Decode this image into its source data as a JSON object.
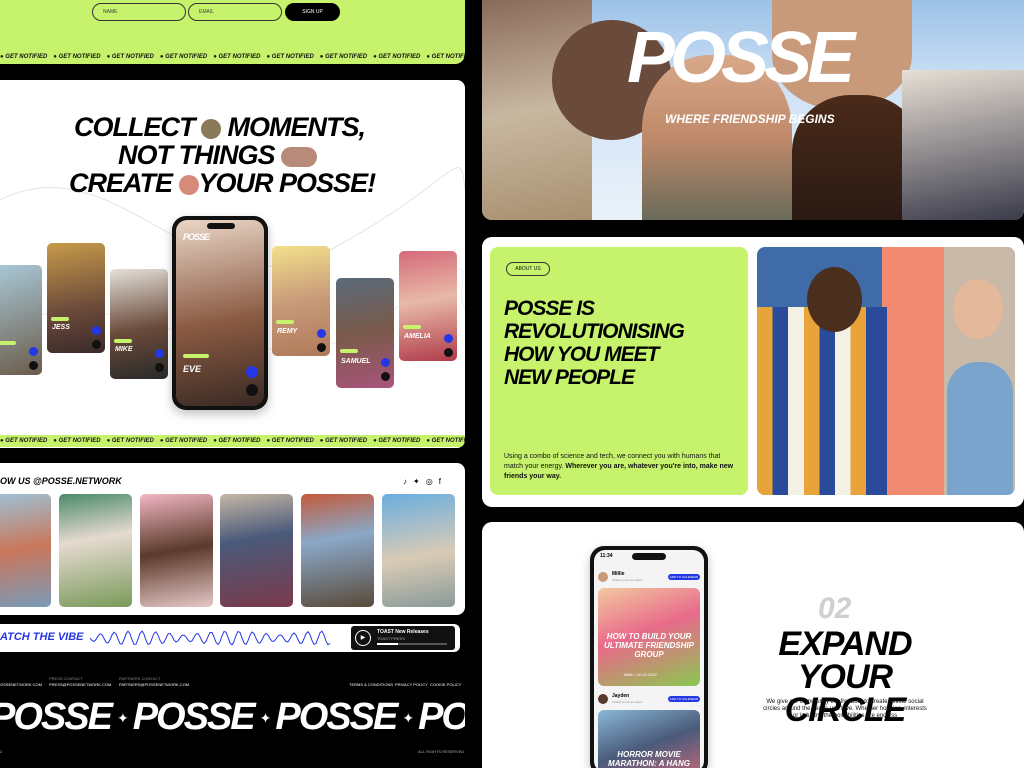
{
  "signup": {
    "name_placeholder": "NAME",
    "email_placeholder": "EMAIL",
    "button": "SIGN UP"
  },
  "ticker_text": "GET NOTIFIED",
  "hero": {
    "line1_a": "COLLECT",
    "line1_b": "MOMENTS,",
    "line2": "NOT THINGS",
    "line3_a": "CREATE",
    "line3_b": "YOUR POSSE!"
  },
  "profiles": [
    {
      "name": "JESS"
    },
    {
      "name": "MIKE"
    },
    {
      "name": "EVE"
    },
    {
      "name": "REMY"
    },
    {
      "name": "SAMUEL"
    },
    {
      "name": "AMELIA"
    }
  ],
  "phone_logo": "POSSE",
  "follow": {
    "prefix": "OW US",
    "handle": "@POSSE.NETWORK"
  },
  "social_icons": [
    "tiktok-icon",
    "twitter-icon",
    "instagram-icon",
    "facebook-icon"
  ],
  "vibe": {
    "label": "ATCH THE VIBE",
    "player_title": "TOAST New Releases",
    "player_sub": "TOAST PRESS"
  },
  "footer": {
    "email1": "OSSENETWORK.COM",
    "press_label": "PRESS CONTACT",
    "press_email": "PRESS@POSSENETWORK.COM",
    "partner_label": "PARTNERS CONTACT",
    "partner_email": "PARTNERS@POSSENETWORK.COM",
    "links": [
      "TERMS & CONDITIONS",
      "PRIVACY POLICY",
      "COOKIE POLICY"
    ],
    "big_word": "POSSE",
    "year": "2",
    "rights": "ALL RIGHTS RESERVED"
  },
  "banner": {
    "logo": "POSSE",
    "tagline": "WHERE FRIENDSHIP BEGINS"
  },
  "about": {
    "pill": "ABOUT US",
    "headline": [
      "POSSE IS",
      "REVOLUTIONISING",
      "HOW YOU MEET",
      "NEW PEOPLE"
    ],
    "body_a": "Using a combo of science and tech, we connect you with humans that match your energy. ",
    "body_b": "Wherever you are, whatever you're into, make new friends your way."
  },
  "expand": {
    "number": "02",
    "title_1": "EXPAND",
    "title_2": "YOUR CIRCLE",
    "body": "We give our community the freedom to create infinite social circles around the things you love. Whether hobbies, interests or industry, the possibilities are endless"
  },
  "app": {
    "time": "11:34",
    "event1": {
      "user": "Millie",
      "sub": "Invited you to an event",
      "btn": "ADD TO CALENDAR",
      "title": "HOW TO BUILD YOUR ULTIMATE FRIENDSHIP GROUP",
      "meta": "Millie • 02.02.2022"
    },
    "event2": {
      "user": "Jayden",
      "sub": "Invited you to an event",
      "btn": "ADD TO CALENDAR",
      "title": "HORROR MOVIE MARATHON: A HANG"
    }
  },
  "colors": {
    "lime": "#c6f36b",
    "black": "#000000",
    "blue": "#2437e5",
    "white": "#ffffff"
  }
}
